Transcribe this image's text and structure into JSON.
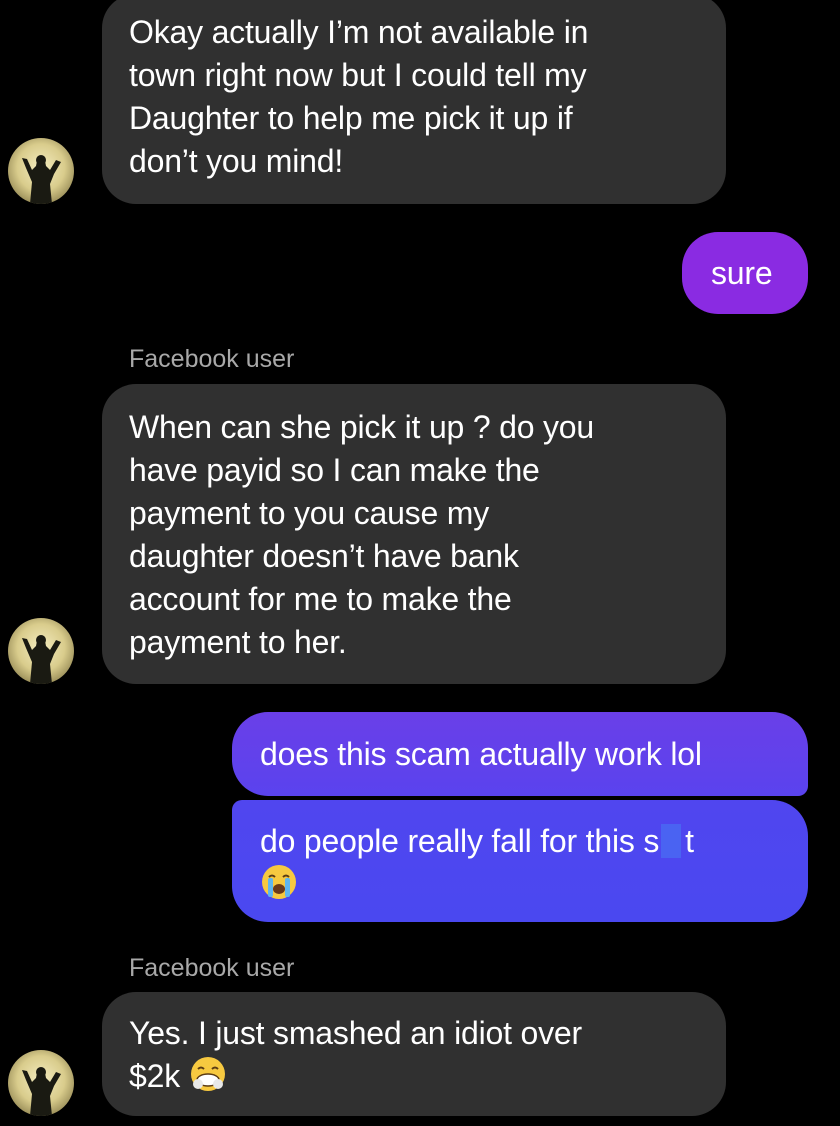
{
  "conversation": {
    "colors": {
      "background": "#000000",
      "incoming_bubble": "#303030",
      "outgoing_purple": "#8a2be2",
      "outgoing_blue": "#5146f0",
      "sender_name": "#a8a8a8"
    },
    "messages": [
      {
        "direction": "incoming",
        "lines": [
          "Okay actually I’m not available in",
          "town right now but I could tell my",
          "Daughter to help me pick it up if",
          "don’t you mind!"
        ]
      },
      {
        "direction": "outgoing",
        "text": "sure"
      },
      {
        "direction": "incoming",
        "sender": "Facebook user",
        "lines": [
          "When can she pick it up ? do you",
          "have payid so I can make the",
          "payment to you cause my",
          "daughter doesn’t have bank",
          "account for me to make the",
          "payment to her."
        ]
      },
      {
        "direction": "outgoing",
        "text": "does this scam actually work lol"
      },
      {
        "direction": "outgoing",
        "text_before_censor": "do people really fall for this s",
        "text_after_censor": "t",
        "emoji": "loudly-crying-face-emoji"
      },
      {
        "direction": "incoming",
        "sender": "Facebook user",
        "lines": [
          "Yes. I just smashed an idiot over",
          "$2k"
        ],
        "emoji": "grimacing-sweat-face-emoji"
      }
    ],
    "avatar_icon": "profile-avatar-icon"
  }
}
